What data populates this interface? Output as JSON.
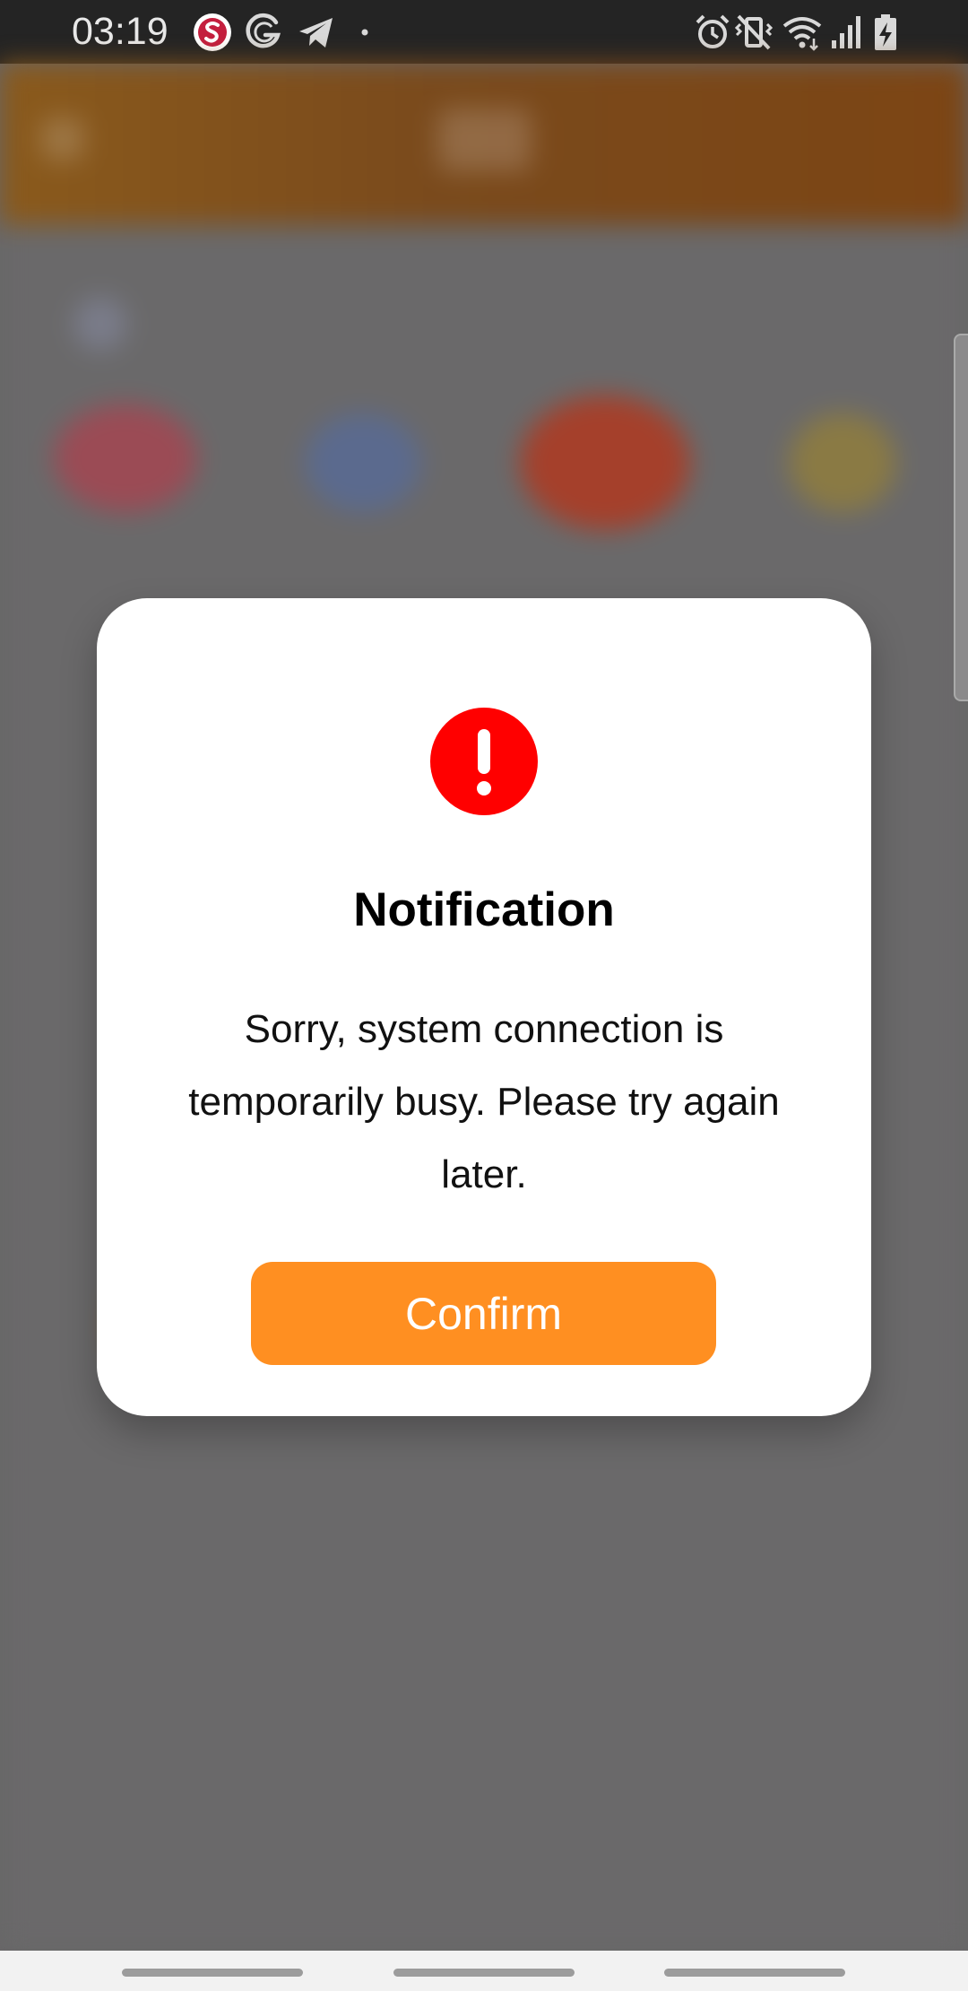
{
  "status_bar": {
    "time": "03:19",
    "left_icons": [
      "shopee-s-icon",
      "g-logo-icon",
      "telegram-icon",
      "more-dot-icon"
    ],
    "right_icons": [
      "alarm-icon",
      "vibrate-mute-icon",
      "wifi-icon",
      "signal-icon",
      "battery-charging-icon"
    ]
  },
  "dialog": {
    "icon": "alert-exclamation-icon",
    "icon_color": "#ff0000",
    "title": "Notification",
    "message": "Sorry, system connection is temporarily busy. Please try again later.",
    "confirm_label": "Confirm",
    "confirm_color": "#ff8f21"
  },
  "colors": {
    "status_bar": "#242424",
    "overlay": "#676667",
    "header_brand": "#7c4a1c"
  }
}
